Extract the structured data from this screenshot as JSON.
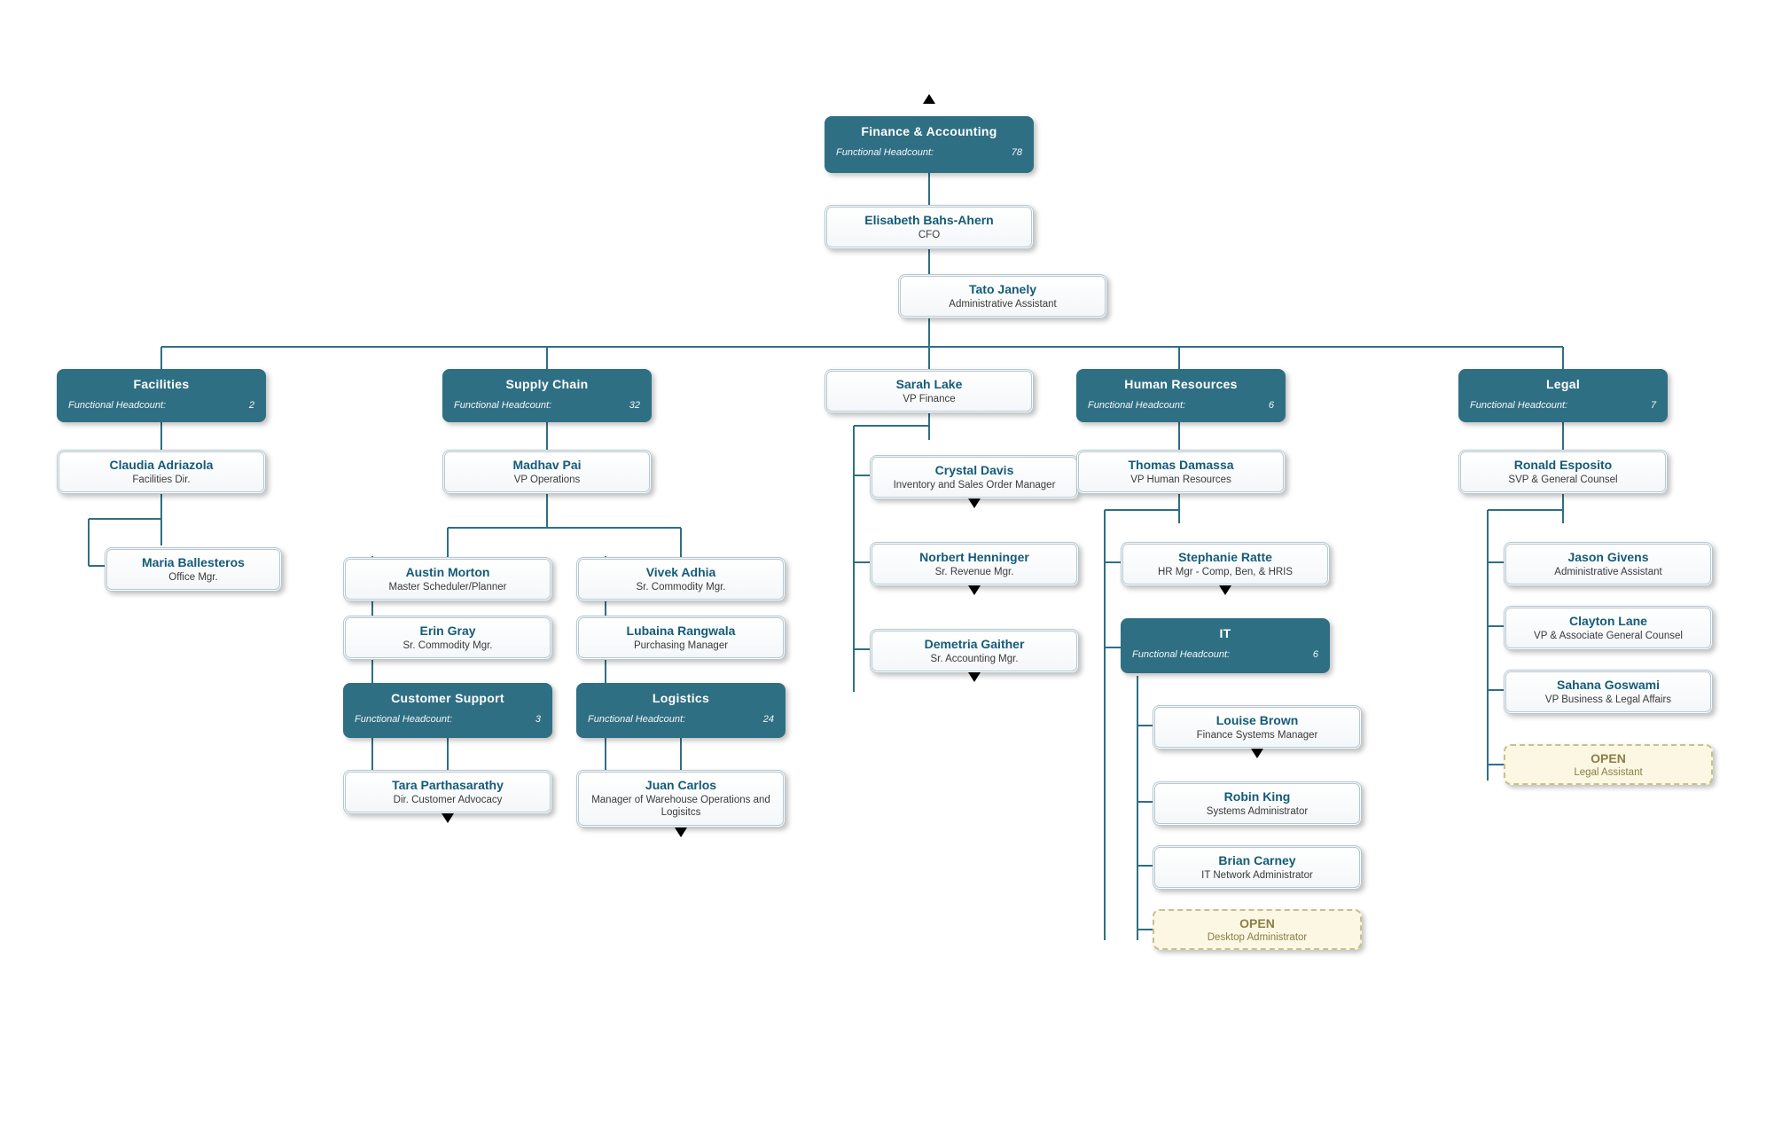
{
  "labels": {
    "headcount": "Functional Headcount:"
  },
  "nodes": {
    "dept_root": {
      "title": "Finance & Accounting",
      "count": 78
    },
    "cfo": {
      "name": "Elisabeth Bahs-Ahern",
      "role": "CFO"
    },
    "admin": {
      "name": "Tato Janely",
      "role": "Administrative Assistant"
    },
    "dept_fac": {
      "title": "Facilities",
      "count": 2
    },
    "fac_dir": {
      "name": "Claudia Adriazola",
      "role": "Facilities Dir."
    },
    "fac_off": {
      "name": "Maria Ballesteros",
      "role": "Office Mgr."
    },
    "dept_sc": {
      "title": "Supply Chain",
      "count": 32
    },
    "sc_vp": {
      "name": "Madhav Pai",
      "role": "VP Operations"
    },
    "sc_a": {
      "name": "Austin Morton",
      "role": "Master Scheduler/Planner"
    },
    "sc_b": {
      "name": "Erin Gray",
      "role": "Sr. Commodity Mgr."
    },
    "sc_c": {
      "name": "Vivek Adhia",
      "role": "Sr. Commodity Mgr."
    },
    "sc_d": {
      "name": "Lubaina Rangwala",
      "role": "Purchasing Manager"
    },
    "dept_cs": {
      "title": "Customer Support",
      "count": 3
    },
    "cs_a": {
      "name": "Tara Parthasarathy",
      "role": "Dir. Customer Advocacy"
    },
    "dept_log": {
      "title": "Logistics",
      "count": 24
    },
    "log_a": {
      "name": "Juan Carlos",
      "role": "Manager of Warehouse Operations and Logisitcs"
    },
    "fin_vp": {
      "name": "Sarah Lake",
      "role": "VP Finance"
    },
    "fin_a": {
      "name": "Crystal Davis",
      "role": "Inventory and Sales Order Manager"
    },
    "fin_b": {
      "name": "Norbert Henninger",
      "role": "Sr. Revenue Mgr."
    },
    "fin_c": {
      "name": "Demetria Gaither",
      "role": "Sr. Accounting Mgr."
    },
    "dept_hr": {
      "title": "Human Resources",
      "count": 6
    },
    "hr_vp": {
      "name": "Thomas Damassa",
      "role": "VP Human Resources"
    },
    "hr_a": {
      "name": "Stephanie Ratte",
      "role": "HR Mgr - Comp, Ben, & HRIS"
    },
    "dept_it": {
      "title": "IT",
      "count": 6
    },
    "it_a": {
      "name": "Louise Brown",
      "role": "Finance Systems Manager"
    },
    "it_b": {
      "name": "Robin King",
      "role": "Systems Administrator"
    },
    "it_c": {
      "name": "Brian Carney",
      "role": "IT Network Administrator"
    },
    "it_open": {
      "name": "OPEN",
      "role": "Desktop Administrator"
    },
    "dept_leg": {
      "title": "Legal",
      "count": 7
    },
    "leg_vp": {
      "name": "Ronald Esposito",
      "role": "SVP & General Counsel"
    },
    "leg_a": {
      "name": "Jason Givens",
      "role": "Administrative Assistant"
    },
    "leg_b": {
      "name": "Clayton Lane",
      "role": "VP & Associate General Counsel"
    },
    "leg_c": {
      "name": "Sahana Goswami",
      "role": "VP Business & Legal Affairs"
    },
    "leg_open": {
      "name": "OPEN",
      "role": "Legal Assistant"
    }
  }
}
